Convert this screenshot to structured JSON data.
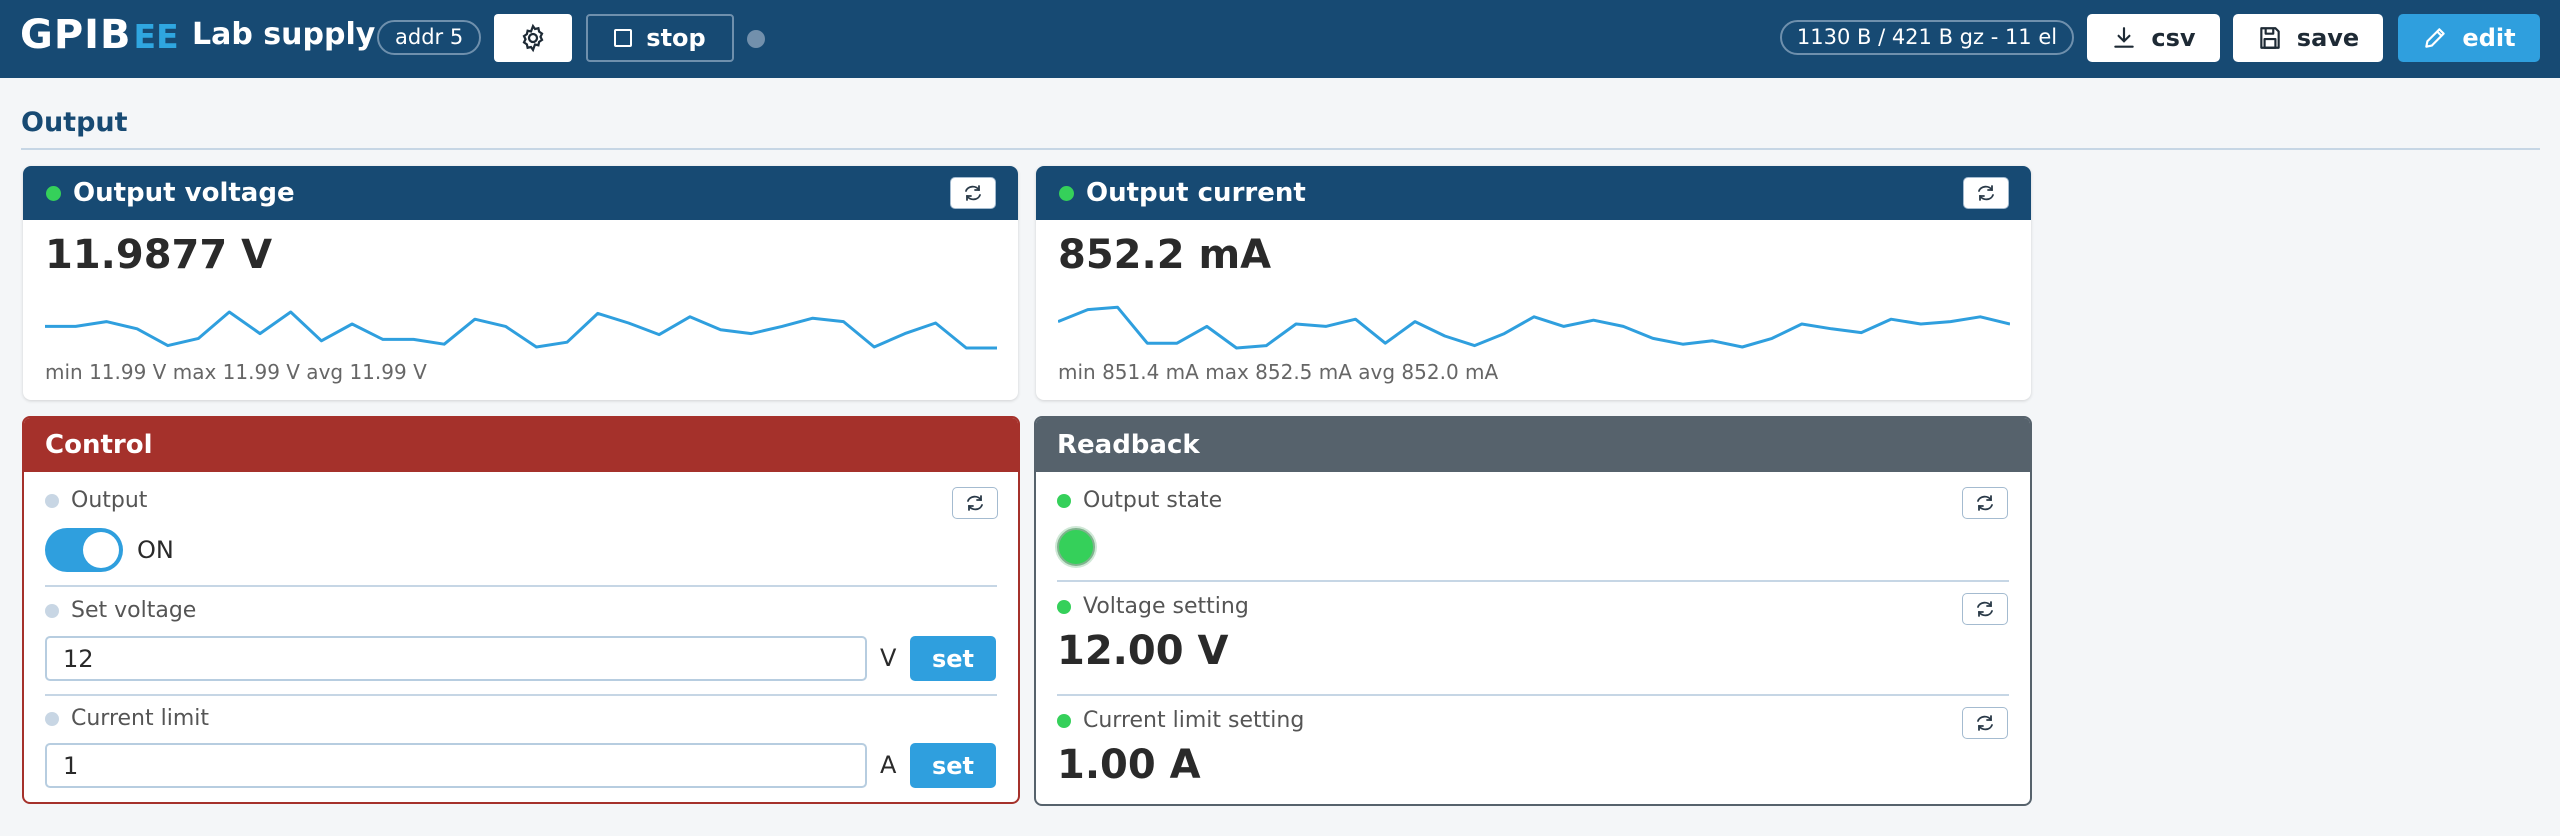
{
  "header": {
    "brand_main": "GPIB",
    "brand_suffix": "EE",
    "app_title": "Lab supply",
    "address_badge": "addr 5",
    "settings_icon": "gear-icon",
    "stop_label": "stop",
    "stats_badge": "1130 B / 421 B gz - 11 el",
    "csv_label": "csv",
    "save_label": "save",
    "edit_label": "edit",
    "accent_color": "#2f9fde",
    "bar_color": "#174a73"
  },
  "section": {
    "title": "Output"
  },
  "output_voltage": {
    "title": "Output voltage",
    "value": "11.9877 V",
    "stats": "min 11.99 V max 11.99 V avg 11.99 V",
    "sparkline": [
      0.55,
      0.55,
      0.45,
      0.6,
      0.95,
      0.8,
      0.25,
      0.7,
      0.25,
      0.85,
      0.5,
      0.82,
      0.82,
      0.92,
      0.4,
      0.55,
      0.98,
      0.88,
      0.28,
      0.48,
      0.72,
      0.35,
      0.62,
      0.7,
      0.55,
      0.38,
      0.45,
      0.98,
      0.7,
      0.48,
      1.0,
      1.0
    ]
  },
  "output_current": {
    "title": "Output current",
    "value": "852.2 mA",
    "stats": "min 851.4 mA max 852.5 mA avg 852.0 mA",
    "sparkline": [
      0.45,
      0.2,
      0.15,
      0.9,
      0.9,
      0.55,
      1.0,
      0.95,
      0.5,
      0.55,
      0.4,
      0.9,
      0.45,
      0.75,
      0.95,
      0.7,
      0.35,
      0.55,
      0.42,
      0.55,
      0.8,
      0.92,
      0.85,
      0.98,
      0.8,
      0.5,
      0.6,
      0.68,
      0.4,
      0.5,
      0.45,
      0.35,
      0.5
    ]
  },
  "control": {
    "title": "Control",
    "header_color": "#a5312b",
    "output_label": "Output",
    "output_state_text": "ON",
    "output_on": true,
    "set_voltage_label": "Set voltage",
    "set_voltage_value": "12",
    "voltage_unit": "V",
    "current_limit_label": "Current limit",
    "current_limit_value": "1",
    "current_unit": "A",
    "set_label": "set"
  },
  "readback": {
    "title": "Readback",
    "header_color": "#56626c",
    "output_state_label": "Output state",
    "output_state_on": true,
    "voltage_setting_label": "Voltage setting",
    "voltage_setting_value": "12.00 V",
    "current_limit_setting_label": "Current limit setting",
    "current_limit_setting_value": "1.00 A"
  }
}
